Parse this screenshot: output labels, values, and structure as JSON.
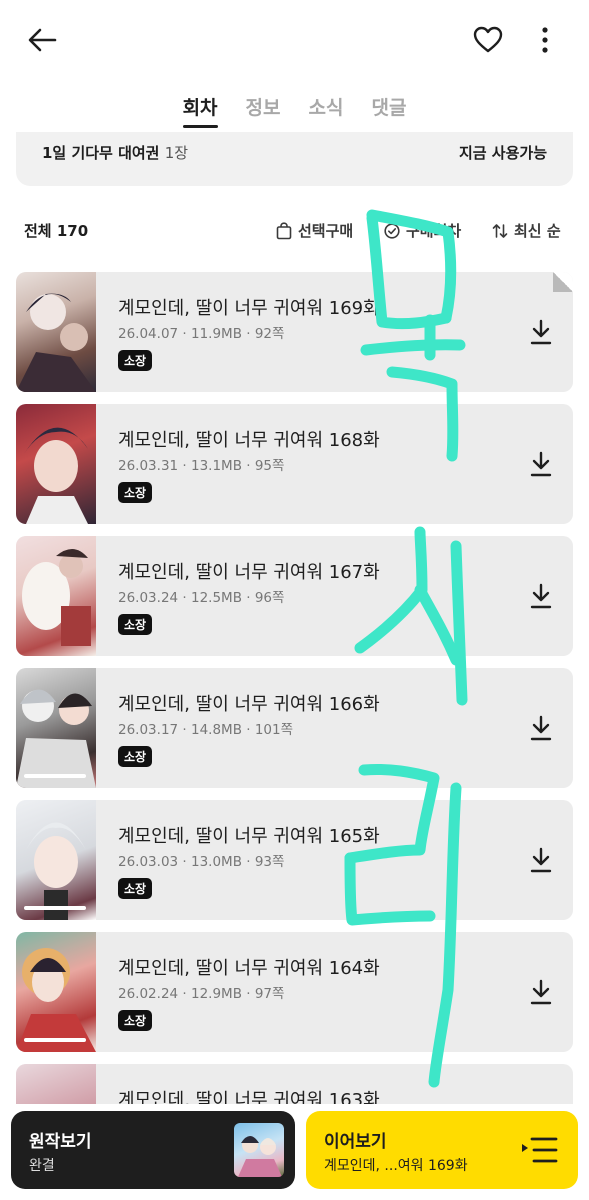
{
  "header": {
    "back_icon": "arrow-left-icon",
    "heart_icon": "heart-icon",
    "more_icon": "more-vertical-icon"
  },
  "tabs": [
    {
      "label": "회차",
      "active": true
    },
    {
      "label": "정보",
      "active": false
    },
    {
      "label": "소식",
      "active": false
    },
    {
      "label": "댓글",
      "active": false
    }
  ],
  "rental": {
    "label": "1일 기다무 대여권",
    "count": "1장",
    "status": "지금 사용가능"
  },
  "toolbar": {
    "total": "전체 170",
    "select_buy": "선택구매",
    "buy_episodes": "구매회차",
    "sort": "최신 순"
  },
  "episodes": [
    {
      "title": "계모인데, 딸이 너무 귀여워 169화",
      "date": "26.04.07",
      "size": "11.9MB",
      "pages": "92쪽",
      "badge": "소장",
      "progress": false,
      "new": true
    },
    {
      "title": "계모인데, 딸이 너무 귀여워 168화",
      "date": "26.03.31",
      "size": "13.1MB",
      "pages": "95쪽",
      "badge": "소장",
      "progress": false,
      "new": false
    },
    {
      "title": "계모인데, 딸이 너무 귀여워 167화",
      "date": "26.03.24",
      "size": "12.5MB",
      "pages": "96쪽",
      "badge": "소장",
      "progress": false,
      "new": false
    },
    {
      "title": "계모인데, 딸이 너무 귀여워 166화",
      "date": "26.03.17",
      "size": "14.8MB",
      "pages": "101쪽",
      "badge": "소장",
      "progress": true,
      "new": false
    },
    {
      "title": "계모인데, 딸이 너무 귀여워 165화",
      "date": "26.03.03",
      "size": "13.0MB",
      "pages": "93쪽",
      "badge": "소장",
      "progress": true,
      "new": false
    },
    {
      "title": "계모인데, 딸이 너무 귀여워 164화",
      "date": "26.02.24",
      "size": "12.9MB",
      "pages": "97쪽",
      "badge": "소장",
      "progress": true,
      "new": false
    },
    {
      "title": "계모인데, 딸이 너무 귀여워 163화",
      "date": "",
      "size": "",
      "pages": "",
      "badge": "",
      "progress": false,
      "new": false
    }
  ],
  "bottom": {
    "original_label": "원작보기",
    "original_status": "완결",
    "continue_label": "이어보기",
    "continue_sub": "계모인데, ...여워 169화"
  },
  "colors": {
    "accent": "#ffdc00",
    "dark": "#1e1e1e",
    "card": "#ececec",
    "scribble": "#3ee6c8"
  }
}
